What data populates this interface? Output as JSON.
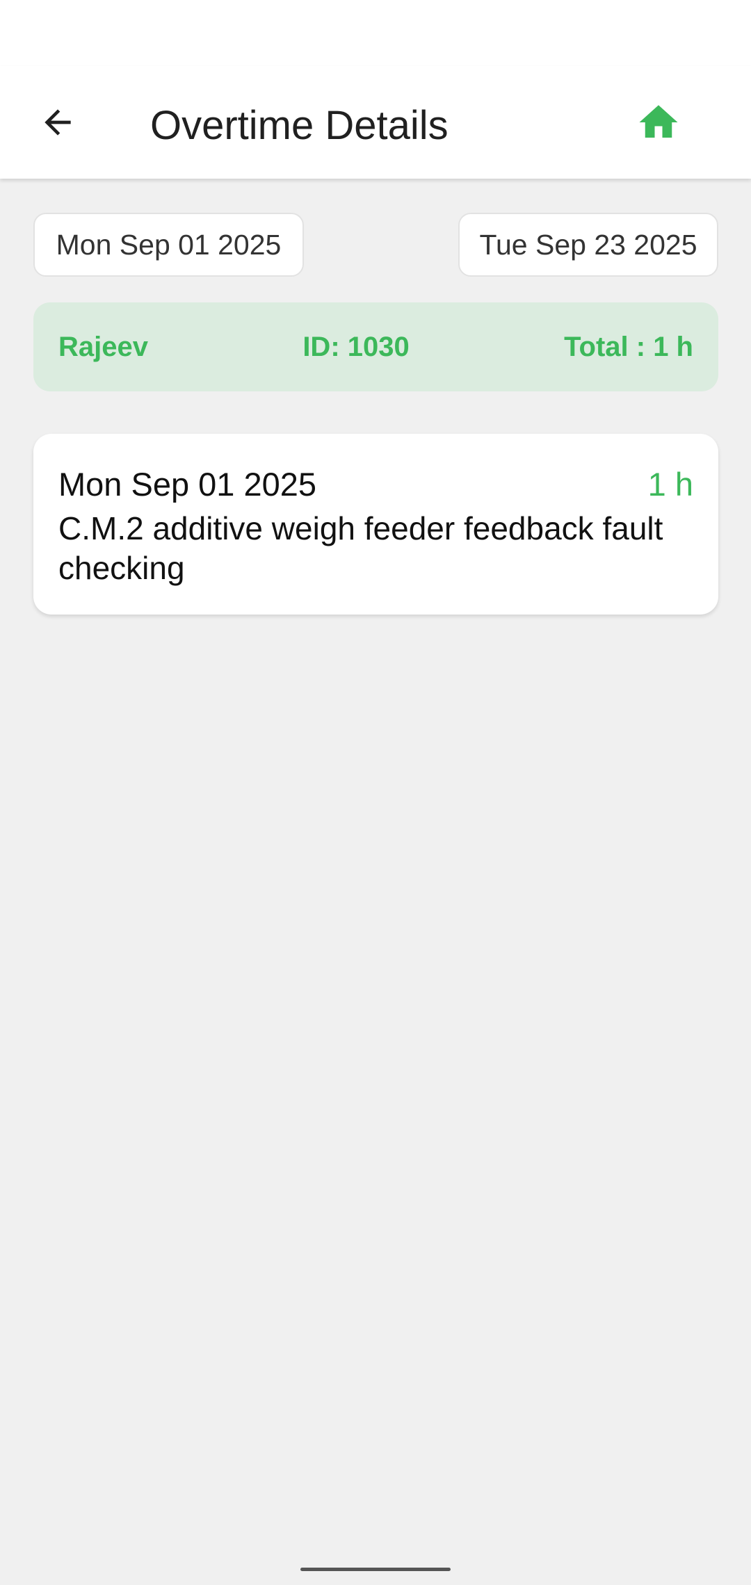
{
  "header": {
    "title": "Overtime Details",
    "back_icon": "arrow-back-icon",
    "home_icon": "home-icon"
  },
  "date_range": {
    "from": "Mon Sep 01 2025",
    "to": "Tue Sep 23 2025"
  },
  "summary": {
    "name": "Rajeev",
    "id": "ID: 1030",
    "total": "Total : 1 h"
  },
  "entries": [
    {
      "date": "Mon Sep 01 2025",
      "hours": "1 h",
      "description": "C.M.2 additive weigh feeder feedback fault checking"
    }
  ],
  "colors": {
    "accent": "#3cb85a",
    "summary_bg": "#dbecdf",
    "background": "#f0f0f0"
  }
}
